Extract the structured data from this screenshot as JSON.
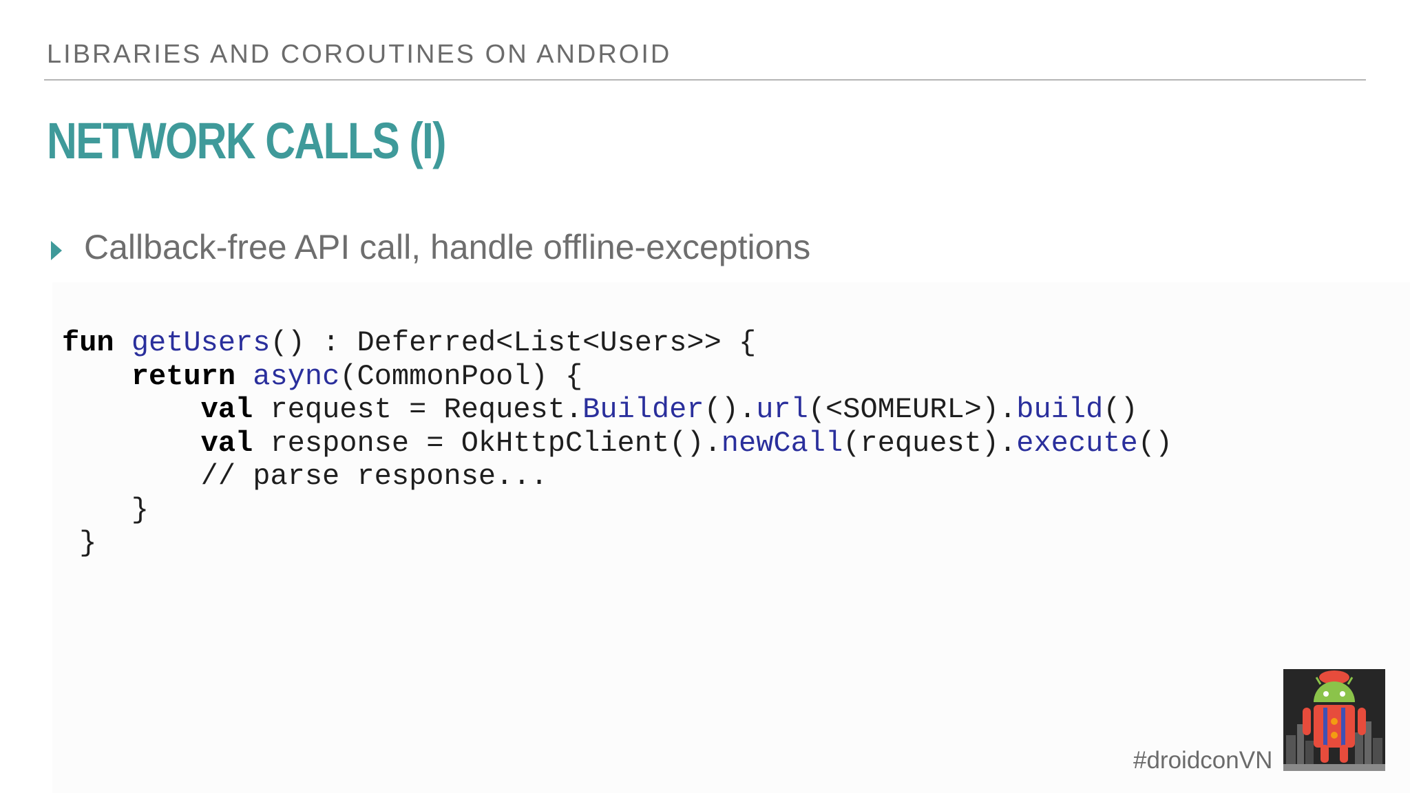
{
  "header": {
    "text": "LIBRARIES AND COROUTINES ON ANDROID"
  },
  "title": "NETWORK CALLS (I)",
  "bullet": {
    "text": "Callback-free API call, handle offline-exceptions"
  },
  "code": {
    "lines": [
      [
        {
          "t": "fun",
          "s": "kw"
        },
        {
          "t": " ",
          "s": ""
        },
        {
          "t": "getUsers",
          "s": "fn"
        },
        {
          "t": "() : Deferred<List<Users>> {",
          "s": ""
        }
      ],
      [
        {
          "t": "    ",
          "s": ""
        },
        {
          "t": "return",
          "s": "kw"
        },
        {
          "t": " ",
          "s": ""
        },
        {
          "t": "async",
          "s": "fn"
        },
        {
          "t": "(CommonPool) {",
          "s": ""
        }
      ],
      [
        {
          "t": "        ",
          "s": ""
        },
        {
          "t": "val",
          "s": "kw"
        },
        {
          "t": " request = Request.",
          "s": ""
        },
        {
          "t": "Builder",
          "s": "fn"
        },
        {
          "t": "().",
          "s": ""
        },
        {
          "t": "url",
          "s": "fn"
        },
        {
          "t": "(<SOMEURL>).",
          "s": ""
        },
        {
          "t": "build",
          "s": "fn"
        },
        {
          "t": "()",
          "s": ""
        }
      ],
      [
        {
          "t": "        ",
          "s": ""
        },
        {
          "t": "val",
          "s": "kw"
        },
        {
          "t": " response = OkHttpClient().",
          "s": ""
        },
        {
          "t": "newCall",
          "s": "fn"
        },
        {
          "t": "(request).",
          "s": ""
        },
        {
          "t": "execute",
          "s": "fn"
        },
        {
          "t": "()",
          "s": ""
        }
      ],
      [
        {
          "t": "        // parse response...",
          "s": ""
        }
      ],
      [
        {
          "t": "    }",
          "s": ""
        }
      ],
      [
        {
          "t": " }",
          "s": ""
        }
      ]
    ]
  },
  "footer": {
    "hashtag": "#droidconVN",
    "logo_icon": "droidcon-vietnam-android-robot-logo",
    "colors": {
      "robot_body": "#e74c3c",
      "robot_head": "#8bc34a",
      "logo_bg": "#2a2a2a"
    }
  }
}
